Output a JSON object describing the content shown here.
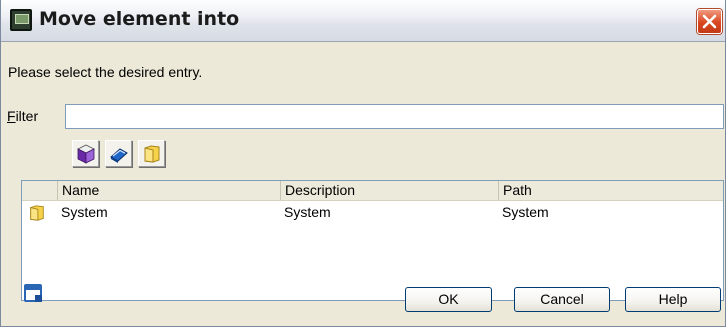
{
  "window": {
    "title": "Move element into"
  },
  "prompt": "Please select the desired entry.",
  "filter": {
    "label": "Filter",
    "value": "",
    "placeholder": ""
  },
  "toolbar": {
    "buttons": [
      "cube-icon",
      "book-icon",
      "folder-icon"
    ]
  },
  "list": {
    "columns": [
      "Name",
      "Description",
      "Path"
    ],
    "rows": [
      {
        "name": "System",
        "description": "System",
        "path": "System",
        "icon": "folder-icon"
      }
    ]
  },
  "buttons": {
    "ok": "OK",
    "cancel": "Cancel",
    "help": "Help"
  },
  "colors": {
    "accent": "#d9461f",
    "titlebar": "#dfe3ea",
    "dialog_bg": "#ece9d8",
    "border": "#7f9db9"
  }
}
